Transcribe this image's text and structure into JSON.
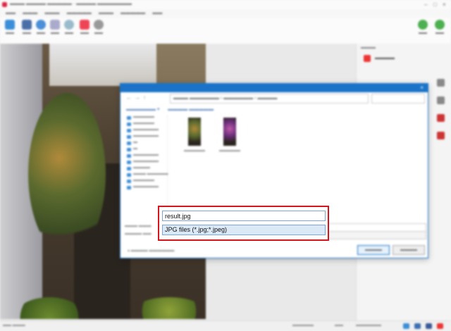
{
  "save_dialog": {
    "file_name": "result.jpg",
    "file_type": "JPG files (*.jpg;*.jpeg)"
  },
  "colors": {
    "highlight_border": "#d8141c",
    "dialog_accent": "#1a73c8",
    "file_type_selected_bg": "#dbe9f7"
  }
}
